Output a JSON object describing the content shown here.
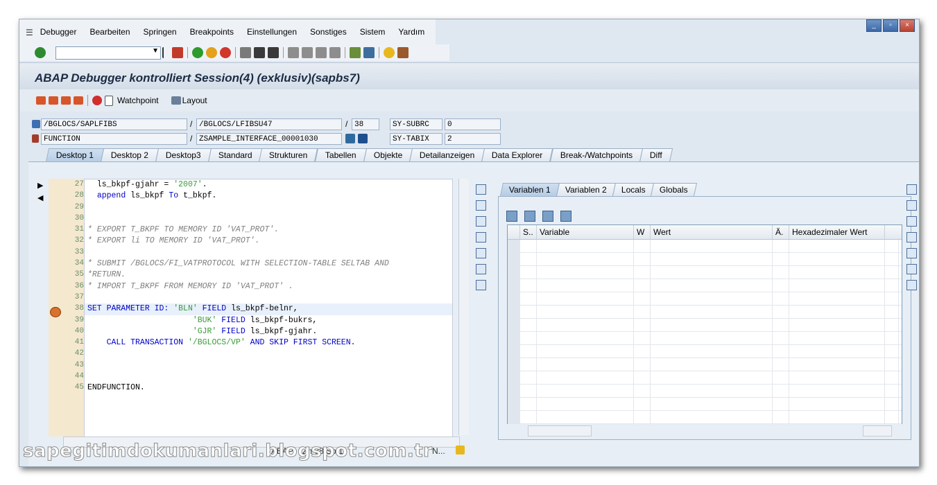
{
  "menu": {
    "items": [
      "Debugger",
      "Bearbeiten",
      "Springen",
      "Breakpoints",
      "Einstellungen",
      "Sonstiges",
      "Sistem",
      "Yardım"
    ]
  },
  "window_controls": [
    "_",
    "▫",
    "×"
  ],
  "header": {
    "title": "ABAP Debugger kontrolliert Session(4)  (exklusiv)(sapbs7)"
  },
  "app_toolbar": {
    "watchpoint": "Watchpoint",
    "layout": "Layout"
  },
  "info": {
    "program": "/BGLOCS/SAPLFIBS",
    "include": "/BGLOCS/LFIBSU47",
    "line": "38",
    "event_type": "FUNCTION",
    "event": "ZSAMPLE_INTERFACE_00001030",
    "sy_subrc_label": "SY-SUBRC",
    "sy_subrc_value": "0",
    "sy_tabix_label": "SY-TABIX",
    "sy_tabix_value": "2"
  },
  "tabs": [
    "Desktop 1",
    "Desktop 2",
    "Desktop3",
    "Standard",
    "Strukturen",
    "Tabellen",
    "Objekte",
    "Detailanzeigen",
    "Data Explorer",
    "Break-/Watchpoints",
    "Diff"
  ],
  "code": {
    "line_numbers": [
      "27",
      "28",
      "29",
      "30",
      "31",
      "32",
      "33",
      "34",
      "35",
      "36",
      "37",
      "38",
      "39",
      "40",
      "41",
      "42",
      "43",
      "44",
      "45"
    ],
    "current_line": "38"
  },
  "right_panel": {
    "tabs": [
      "Variablen 1",
      "Variablen 2",
      "Locals",
      "Globals"
    ],
    "columns": {
      "s": "S..",
      "variable": "Variable",
      "w": "W",
      "wert": "Wert",
      "a": "Ä.",
      "hex": "Hexadezimaler Wert"
    }
  },
  "status": {
    "abap": "ABAP",
    "position": "Zn 38 Sp 1",
    "nav": "N..."
  },
  "watermark": "sapegitimdokumanlari.blogspot.com.tr"
}
